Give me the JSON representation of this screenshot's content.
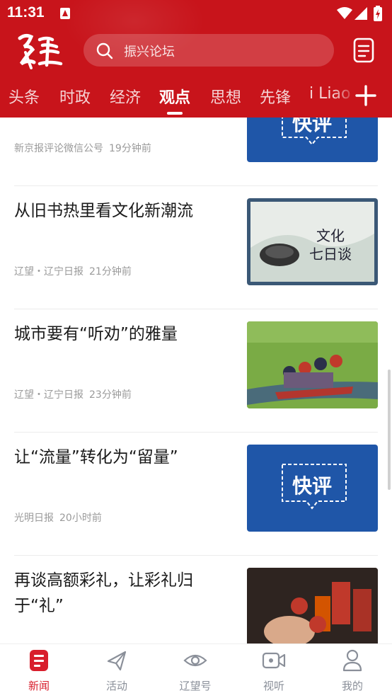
{
  "status_bar": {
    "time": "11:31"
  },
  "header": {
    "logo_text": "辽望",
    "search_placeholder": "振兴论坛",
    "icons": [
      "search-icon",
      "document-icon",
      "plus-icon"
    ]
  },
  "tabs": [
    {
      "label": "头条"
    },
    {
      "label": "时政"
    },
    {
      "label": "经济"
    },
    {
      "label": "观点",
      "active": true
    },
    {
      "label": "思想"
    },
    {
      "label": "先锋"
    },
    {
      "label": "i Liao"
    }
  ],
  "feed": [
    {
      "title": "",
      "source": "新京报评论微信公号",
      "time": "19分钟前",
      "thumb": "快评"
    },
    {
      "title": "从旧书热里看文化新潮流",
      "source": "辽望・辽宁日报",
      "time": "21分钟前",
      "thumb": "文化 七日谈"
    },
    {
      "title": "城市要有“听劝”的雅量",
      "source": "辽望・辽宁日报",
      "time": "23分钟前",
      "thumb": ""
    },
    {
      "title": "让“流量”转化为“留量”",
      "source": "光明日报",
      "time": "20小时前",
      "thumb": "快评"
    },
    {
      "title": "再谈高额彩礼，让彩礼归于“礼”",
      "source": "",
      "time": "",
      "thumb": ""
    }
  ],
  "thumb_text": {
    "kuaiping": "快评",
    "wenhua": "文化",
    "qiri": "七日谈"
  },
  "bottom_nav": [
    {
      "label": "新闻",
      "icon": "news-icon",
      "active": true
    },
    {
      "label": "活动",
      "icon": "paper-plane-icon"
    },
    {
      "label": "辽望号",
      "icon": "eye-icon"
    },
    {
      "label": "视听",
      "icon": "video-icon"
    },
    {
      "label": "我的",
      "icon": "user-icon"
    }
  ],
  "colors": {
    "brand": "#c8141b",
    "active_nav": "#d81e2c",
    "thumb_blue": "#1f56a8"
  }
}
